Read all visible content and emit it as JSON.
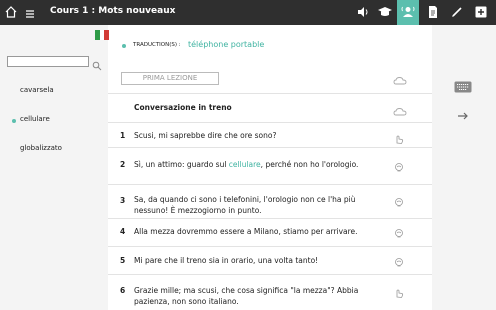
{
  "header": {
    "title": "Cours 1 : Mots nouveaux",
    "accent_color": "#5cbfae"
  },
  "toolbar": {
    "icons": [
      "speaker-icon",
      "graduation-cap-icon",
      "listen-user-icon",
      "document-icon",
      "pencil-icon",
      "plus-icon"
    ],
    "active": "listen-user-icon"
  },
  "sidebar": {
    "search_placeholder": "",
    "words": [
      {
        "label": "cavarsela",
        "selected": false
      },
      {
        "label": "cellulare",
        "selected": true
      },
      {
        "label": "globalizzato",
        "selected": false
      }
    ]
  },
  "main": {
    "translation_label": "TRADUCTION(S) :",
    "translation_value": "téléphone portable",
    "lesson_button": "PRIMA LEZIONE",
    "conversation_title": "Conversazione in treno",
    "lines": [
      {
        "num": "1",
        "text": "Scusi, mi saprebbe dire che ore sono?"
      },
      {
        "num": "2",
        "pre": "Sì, un attimo: guardo sul ",
        "highlight": "cellulare",
        "post": ", perché non ho l'orologio."
      },
      {
        "num": "3",
        "text": "Sa, da quando ci sono i telefonini, l'orologio non ce l'ha più nessuno! È mezzogiorno in punto."
      },
      {
        "num": "4",
        "text": "Alla mezza dovremmo essere a Milano, stiamo per arrivare."
      },
      {
        "num": "5",
        "text": "Mi pare che il treno sia in orario, una volta tanto!"
      },
      {
        "num": "6",
        "text": "Grazie mille; ma scusi, che cosa significa \"la mezza\"? Abbia pazienza, non sono italiano."
      }
    ]
  }
}
